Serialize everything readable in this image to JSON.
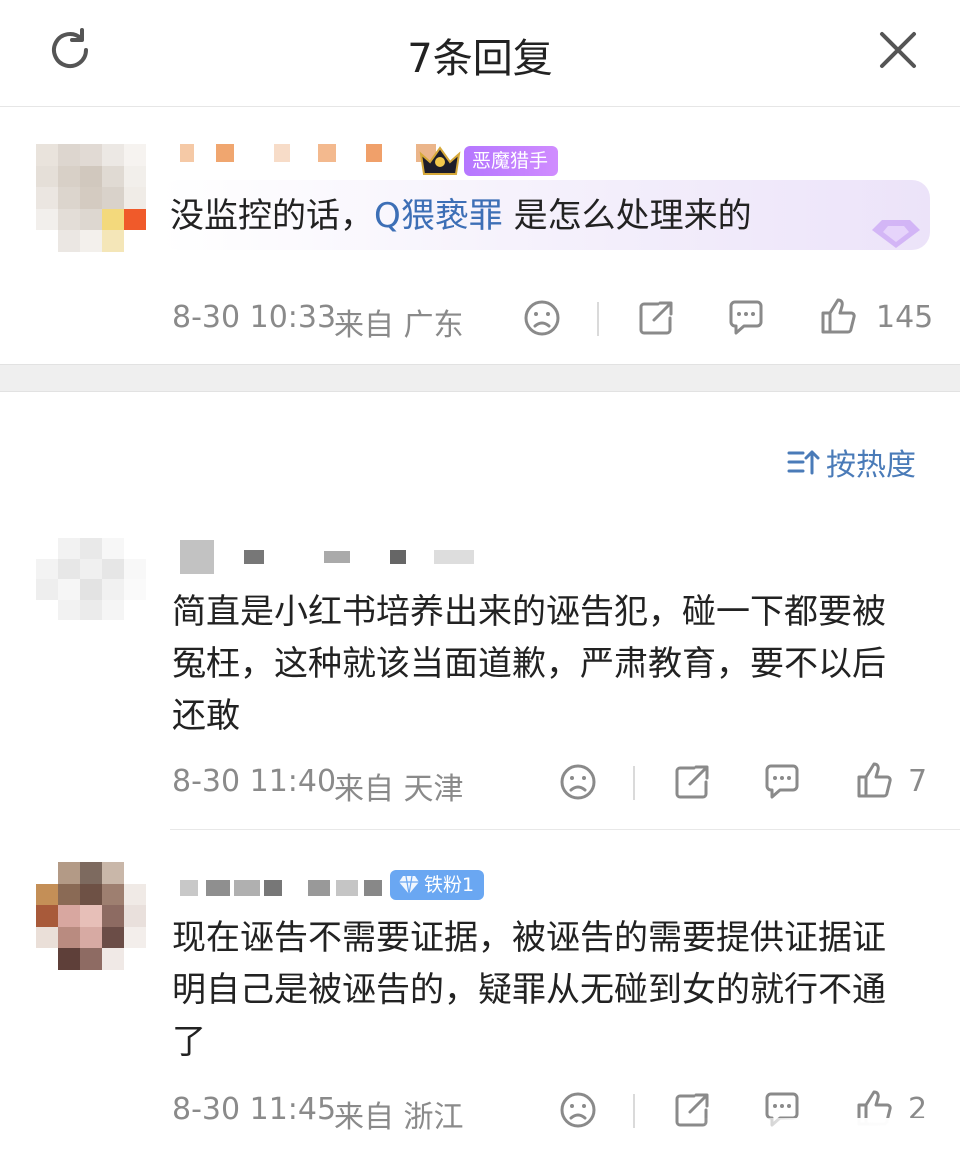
{
  "header": {
    "title": "7条回复"
  },
  "main_comment": {
    "badge": "恶魔猎手",
    "text_before": "没监控的话，",
    "link_text": "Q猥亵罪",
    "text_after": " 是怎么处理来的",
    "date": "8-30 10:33",
    "location": "来自 广东",
    "likes": "145"
  },
  "sort": {
    "label": "按热度"
  },
  "replies": [
    {
      "text": "简直是小红书培养出来的诬告犯，碰一下都要被冤枉，这种就该当面道歉，严肃教育，要不以后还敢",
      "date": "8-30 11:40",
      "location": "来自 天津",
      "likes": "7"
    },
    {
      "badge": "铁粉1",
      "text": "现在诬告不需要证据，被诬告的需要提供证据证明自己是被诬告的，疑罪从无碰到女的就行不通了",
      "date": "8-30 11:45",
      "location": "来自 浙江",
      "likes": "2"
    }
  ],
  "colors": {
    "link": "#3d6fb6",
    "meta": "#8a8a8a",
    "badge_purple": "#b577ff",
    "badge_blue": "#6aa7f2"
  },
  "icons": [
    "refresh-icon",
    "close-icon",
    "dislike-icon",
    "share-icon",
    "comment-icon",
    "like-icon",
    "sort-icon",
    "crown-icon",
    "diamond-icon"
  ]
}
